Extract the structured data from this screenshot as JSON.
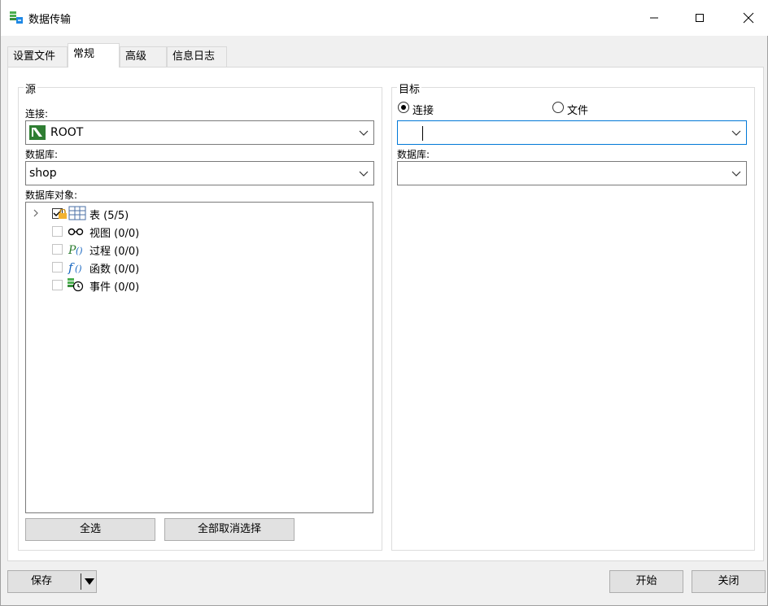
{
  "window": {
    "title": "数据传输"
  },
  "tabs": [
    {
      "label": "设置文件"
    },
    {
      "label": "常规"
    },
    {
      "label": "高级"
    },
    {
      "label": "信息日志"
    }
  ],
  "source": {
    "legend": "源",
    "connection_label": "连接:",
    "connection_value": "ROOT",
    "database_label": "数据库:",
    "database_value": "shop",
    "objects_label": "数据库对象:",
    "objects": [
      {
        "label": "表  (5/5)"
      },
      {
        "label": "视图  (0/0)"
      },
      {
        "label": "过程  (0/0)"
      },
      {
        "label": "函数  (0/0)"
      },
      {
        "label": "事件  (0/0)"
      }
    ],
    "select_all": "全选",
    "deselect_all": "全部取消选择"
  },
  "target": {
    "legend": "目标",
    "radio_connection": "连接",
    "radio_file": "文件",
    "connection_value": "",
    "database_label": "数据库:",
    "database_value": ""
  },
  "footer": {
    "save": "保存",
    "start": "开始",
    "close": "关闭"
  }
}
